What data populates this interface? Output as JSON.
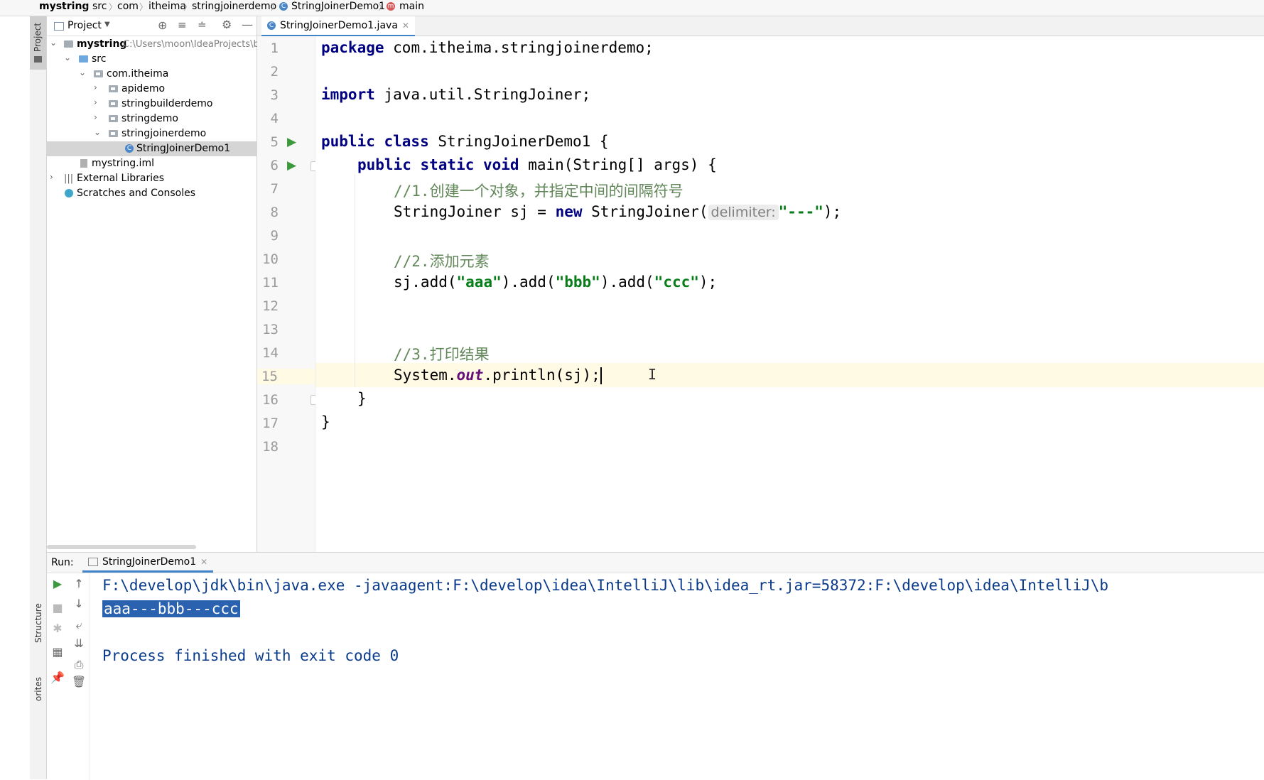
{
  "breadcrumb": [
    "mystring",
    "src",
    "com",
    "itheima",
    "stringjoinerdemo",
    "StringJoinerDemo1",
    "main"
  ],
  "tool_strip": {
    "project_tab": "Project",
    "structure_tab": "Structure",
    "favorites_tab": "orites"
  },
  "project": {
    "header_label": "Project",
    "tree": [
      {
        "label": "mystring",
        "extra": "C:\\Users\\moon\\IdeaProjects\\b"
      },
      {
        "label": "src"
      },
      {
        "label": "com.itheima"
      },
      {
        "label": "apidemo"
      },
      {
        "label": "stringbuilderdemo"
      },
      {
        "label": "stringdemo"
      },
      {
        "label": "stringjoinerdemo"
      },
      {
        "label": "StringJoinerDemo1"
      },
      {
        "label": "mystring.iml"
      },
      {
        "label": "External Libraries"
      },
      {
        "label": "Scratches and Consoles"
      }
    ]
  },
  "editor": {
    "tab_label": "StringJoinerDemo1.java",
    "line_numbers": [
      "1",
      "2",
      "3",
      "4",
      "5",
      "6",
      "7",
      "8",
      "9",
      "10",
      "11",
      "12",
      "13",
      "14",
      "15",
      "16",
      "17",
      "18"
    ],
    "l1_kw": "package",
    "l1_rest": " com.itheima.stringjoinerdemo;",
    "l3_kw": "import",
    "l3_rest": " java.util.StringJoiner;",
    "l5_kw": "public class",
    "l5_rest": " StringJoinerDemo1 {",
    "l6_kw": "public static void",
    "l6_rest": " main(String[] args) {",
    "l7_comment": "//1.创建一个对象，并指定中间的间隔符号",
    "l8_a": "StringJoiner sj = ",
    "l8_kw": "new",
    "l8_b": " StringJoiner(",
    "l8_hint": "delimiter:",
    "l8_str": "\"---\"",
    "l8_end": ");",
    "l10_comment": "//2.添加元素",
    "l11_a": "sj.add(",
    "l11_s1": "\"aaa\"",
    "l11_b": ").add(",
    "l11_s2": "\"bbb\"",
    "l11_c": ").add(",
    "l11_s3": "\"ccc\"",
    "l11_end": ");",
    "l14_comment": "//3.打印结果",
    "l15_a": "System.",
    "l15_out": "out",
    "l15_b": ".println(sj);",
    "l16": "}",
    "l17": "}"
  },
  "run": {
    "label": "Run:",
    "config_tab": "StringJoinerDemo1",
    "command": "F:\\develop\\jdk\\bin\\java.exe -javaagent:F:\\develop\\idea\\IntelliJ\\lib\\idea_rt.jar=58372:F:\\develop\\idea\\IntelliJ\\b",
    "output": "aaa---bbb---ccc",
    "exit": "Process finished with exit code 0"
  }
}
